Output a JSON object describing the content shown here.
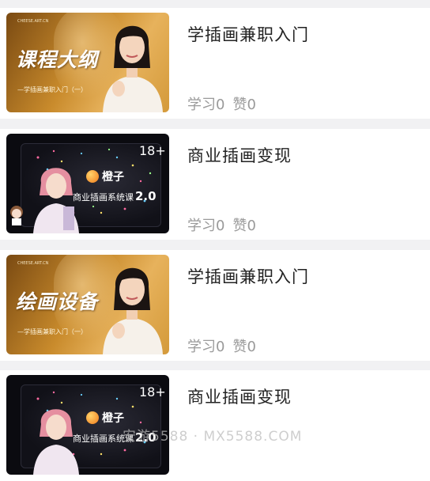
{
  "courses": [
    {
      "title": "学插画兼职入门",
      "learn": "学习0",
      "likes": "赞0",
      "thumb": {
        "style": "gold",
        "headline": "课程大纲",
        "subtitle": "—学插画兼职入门（一）",
        "tiny": "CHEESE.ART.CN"
      }
    },
    {
      "title": "商业插画变现",
      "learn": "学习0",
      "likes": "赞0",
      "thumb": {
        "style": "dark",
        "age": "18+",
        "brand": "橙子",
        "course": "商业插画系统课",
        "version": "2.0"
      }
    },
    {
      "title": "学插画兼职入门",
      "learn": "学习0",
      "likes": "赞0",
      "thumb": {
        "style": "gold",
        "headline": "绘画设备",
        "subtitle": "—学插画兼职入门（一）",
        "tiny": "CHEESE.ART.CN"
      }
    },
    {
      "title": "商业插画变现",
      "learn": "学习0",
      "likes": "赞0",
      "thumb": {
        "style": "dark",
        "age": "18+",
        "brand": "橙子",
        "course": "商业插画系统课",
        "version": "2.0"
      }
    }
  ],
  "watermark": "安游5588 · MX5588.COM",
  "colors": {
    "title": "#222222",
    "meta": "#9a9a9a",
    "background": "#f1f1f3",
    "card": "#ffffff",
    "thumb_gold": "#c98b2c",
    "thumb_dark": "#0b0b10"
  }
}
